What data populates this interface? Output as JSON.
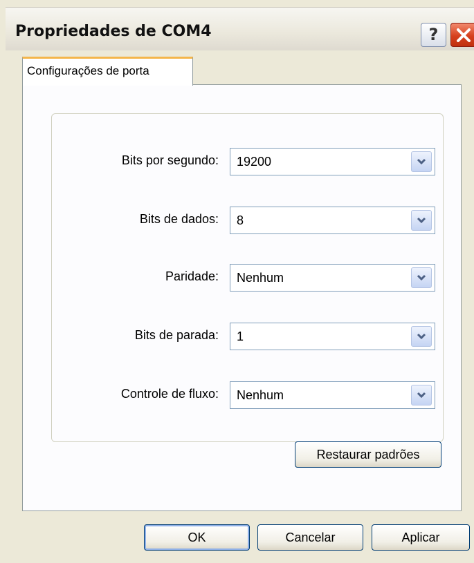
{
  "window": {
    "title": "Propriedades de COM4",
    "help_glyph": "?"
  },
  "tabs": [
    {
      "label": "Configurações de porta",
      "selected": true
    }
  ],
  "settings": [
    {
      "label": "Bits por segundo:",
      "value": "19200"
    },
    {
      "label": "Bits de dados:",
      "value": "8"
    },
    {
      "label": "Paridade:",
      "value": "Nenhum"
    },
    {
      "label": "Bits de parada:",
      "value": "1"
    },
    {
      "label": "Controle de fluxo:",
      "value": "Nenhum"
    }
  ],
  "restore_button": {
    "label": "Restaurar padrões"
  },
  "footer": {
    "ok_label": "OK",
    "cancel_label": "Cancelar",
    "apply_label": "Aplicar"
  },
  "colors": {
    "dialog_background": "#ece9d8",
    "tab_accent": "#f4b54a",
    "close_button": "#d6401e",
    "field_border": "#7f9db9"
  }
}
